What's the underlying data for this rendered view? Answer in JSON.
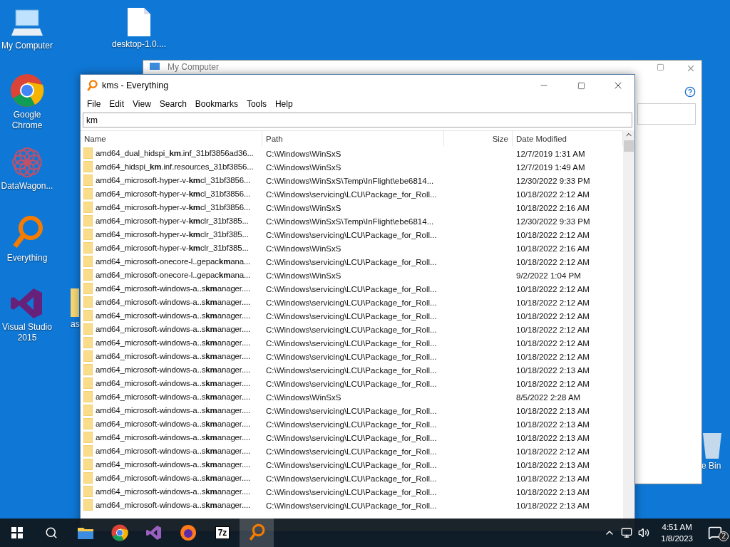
{
  "desktop_icons": [
    {
      "kind": "computer",
      "label": "My Computer"
    },
    {
      "kind": "file",
      "label": "desktop-1.0...."
    },
    {
      "kind": "chrome",
      "label": "Google Chrome"
    },
    {
      "kind": "datawagon",
      "label": "DataWagon..."
    },
    {
      "kind": "everything",
      "label": "Everything"
    },
    {
      "kind": "vs",
      "label": "Visual Studio 2015"
    },
    {
      "kind": "folder",
      "label": "as"
    },
    {
      "kind": "recycle",
      "label": "e Bin"
    }
  ],
  "background_window": {
    "title": "My Computer"
  },
  "window": {
    "title": "kms - Everything"
  },
  "menu": [
    "File",
    "Edit",
    "View",
    "Search",
    "Bookmarks",
    "Tools",
    "Help"
  ],
  "search": {
    "value": "km"
  },
  "table": {
    "columns": [
      "Name",
      "Path",
      "Size",
      "Date Modified"
    ],
    "rows": [
      {
        "name": "amd64_dual_hidspi_**km**.inf_31bf3856ad36...",
        "path": "C:\\Windows\\WinSxS",
        "date": "12/7/2019 1:31 AM"
      },
      {
        "name": "amd64_hidspi_**km**.inf.resources_31bf3856...",
        "path": "C:\\Windows\\WinSxS",
        "date": "12/7/2019 1:49 AM"
      },
      {
        "name": "amd64_microsoft-hyper-v-**km**cl_31bf3856...",
        "path": "C:\\Windows\\WinSxS\\Temp\\InFlight\\ebe6814...",
        "date": "12/30/2022 9:33 PM"
      },
      {
        "name": "amd64_microsoft-hyper-v-**km**cl_31bf3856...",
        "path": "C:\\Windows\\servicing\\LCU\\Package_for_Roll...",
        "date": "10/18/2022 2:12 AM"
      },
      {
        "name": "amd64_microsoft-hyper-v-**km**cl_31bf3856...",
        "path": "C:\\Windows\\WinSxS",
        "date": "10/18/2022 2:16 AM"
      },
      {
        "name": "amd64_microsoft-hyper-v-**km**clr_31bf385...",
        "path": "C:\\Windows\\WinSxS\\Temp\\InFlight\\ebe6814...",
        "date": "12/30/2022 9:33 PM"
      },
      {
        "name": "amd64_microsoft-hyper-v-**km**clr_31bf385...",
        "path": "C:\\Windows\\servicing\\LCU\\Package_for_Roll...",
        "date": "10/18/2022 2:12 AM"
      },
      {
        "name": "amd64_microsoft-hyper-v-**km**clr_31bf385...",
        "path": "C:\\Windows\\WinSxS",
        "date": "10/18/2022 2:16 AM"
      },
      {
        "name": "amd64_microsoft-onecore-l..gepac**km**ana...",
        "path": "C:\\Windows\\servicing\\LCU\\Package_for_Roll...",
        "date": "10/18/2022 2:12 AM"
      },
      {
        "name": "amd64_microsoft-onecore-l..gepac**km**ana...",
        "path": "C:\\Windows\\WinSxS",
        "date": "9/2/2022 1:04 PM"
      },
      {
        "name": "amd64_microsoft-windows-a..s**km**anager....",
        "path": "C:\\Windows\\servicing\\LCU\\Package_for_Roll...",
        "date": "10/18/2022 2:12 AM"
      },
      {
        "name": "amd64_microsoft-windows-a..s**km**anager....",
        "path": "C:\\Windows\\servicing\\LCU\\Package_for_Roll...",
        "date": "10/18/2022 2:12 AM"
      },
      {
        "name": "amd64_microsoft-windows-a..s**km**anager....",
        "path": "C:\\Windows\\servicing\\LCU\\Package_for_Roll...",
        "date": "10/18/2022 2:12 AM"
      },
      {
        "name": "amd64_microsoft-windows-a..s**km**anager....",
        "path": "C:\\Windows\\servicing\\LCU\\Package_for_Roll...",
        "date": "10/18/2022 2:12 AM"
      },
      {
        "name": "amd64_microsoft-windows-a..s**km**anager....",
        "path": "C:\\Windows\\servicing\\LCU\\Package_for_Roll...",
        "date": "10/18/2022 2:12 AM"
      },
      {
        "name": "amd64_microsoft-windows-a..s**km**anager....",
        "path": "C:\\Windows\\servicing\\LCU\\Package_for_Roll...",
        "date": "10/18/2022 2:12 AM"
      },
      {
        "name": "amd64_microsoft-windows-a..s**km**anager....",
        "path": "C:\\Windows\\servicing\\LCU\\Package_for_Roll...",
        "date": "10/18/2022 2:13 AM"
      },
      {
        "name": "amd64_microsoft-windows-a..s**km**anager....",
        "path": "C:\\Windows\\servicing\\LCU\\Package_for_Roll...",
        "date": "10/18/2022 2:12 AM"
      },
      {
        "name": "amd64_microsoft-windows-a..s**km**anager....",
        "path": "C:\\Windows\\WinSxS",
        "date": "8/5/2022 2:28 AM"
      },
      {
        "name": "amd64_microsoft-windows-a..s**km**anager....",
        "path": "C:\\Windows\\servicing\\LCU\\Package_for_Roll...",
        "date": "10/18/2022 2:13 AM"
      },
      {
        "name": "amd64_microsoft-windows-a..s**km**anager....",
        "path": "C:\\Windows\\servicing\\LCU\\Package_for_Roll...",
        "date": "10/18/2022 2:13 AM"
      },
      {
        "name": "amd64_microsoft-windows-a..s**km**anager....",
        "path": "C:\\Windows\\servicing\\LCU\\Package_for_Roll...",
        "date": "10/18/2022 2:13 AM"
      },
      {
        "name": "amd64_microsoft-windows-a..s**km**anager....",
        "path": "C:\\Windows\\servicing\\LCU\\Package_for_Roll...",
        "date": "10/18/2022 2:12 AM"
      },
      {
        "name": "amd64_microsoft-windows-a..s**km**anager....",
        "path": "C:\\Windows\\servicing\\LCU\\Package_for_Roll...",
        "date": "10/18/2022 2:13 AM"
      },
      {
        "name": "amd64_microsoft-windows-a..s**km**anager....",
        "path": "C:\\Windows\\servicing\\LCU\\Package_for_Roll...",
        "date": "10/18/2022 2:13 AM"
      },
      {
        "name": "amd64_microsoft-windows-a..s**km**anager....",
        "path": "C:\\Windows\\servicing\\LCU\\Package_for_Roll...",
        "date": "10/18/2022 2:13 AM"
      },
      {
        "name": "amd64_microsoft-windows-a..s**km**anager....",
        "path": "C:\\Windows\\servicing\\LCU\\Package_for_Roll...",
        "date": "10/18/2022 2:13 AM"
      }
    ]
  },
  "taskbar": {
    "apps": [
      {
        "kind": "explorer",
        "selected": false
      },
      {
        "kind": "chrome",
        "selected": false
      },
      {
        "kind": "vs",
        "selected": false
      },
      {
        "kind": "firefox",
        "selected": false
      },
      {
        "kind": "sevenzip",
        "label": "7z",
        "selected": false
      },
      {
        "kind": "everything",
        "selected": true
      }
    ],
    "time": "4:51 AM",
    "date": "1/8/2023",
    "notifications": "2"
  }
}
